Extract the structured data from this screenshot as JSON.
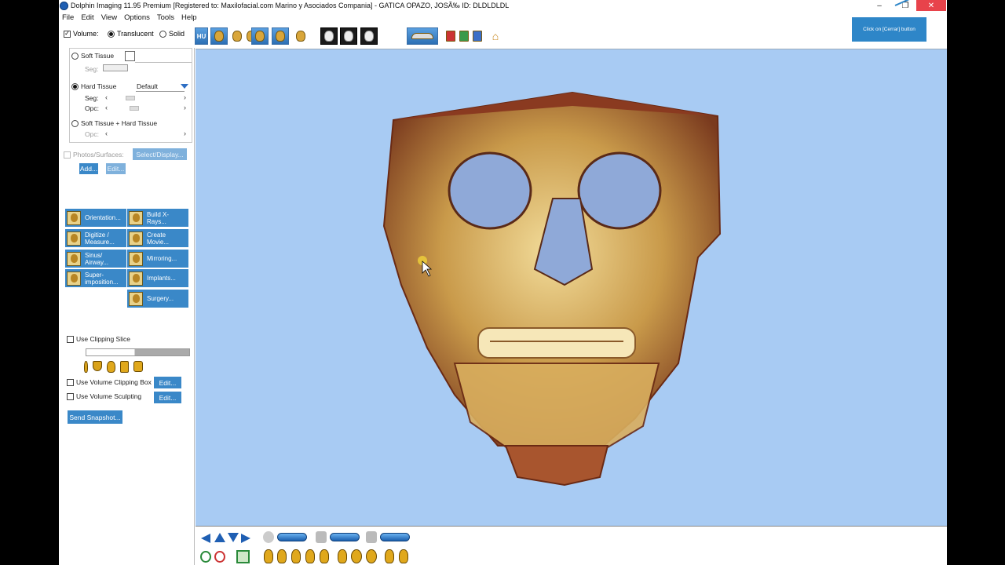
{
  "window": {
    "title": "Dolphin Imaging 11.95 Premium [Registered to: Maxilofacial.com Marino y Asociados Compania] - GATICA OPAZO, JOSÃ‰  ID: DLDLDLDL",
    "minimize": "–",
    "maximize": "❐",
    "close": "✕"
  },
  "menu": [
    "File",
    "Edit",
    "View",
    "Options",
    "Tools",
    "Help"
  ],
  "tooltip": "Click on [Cerrar] button",
  "toolbar": {
    "volume_label": "Volume:",
    "translucent_label": "Translucent",
    "solid_label": "Solid",
    "hu_label": "HU"
  },
  "tissue": {
    "soft_label": "Soft Tissue",
    "seg_label": "Seg:",
    "hard_label": "Hard Tissue",
    "preset_value": "Default",
    "opc_label": "Opc:",
    "soft_hard_label": "Soft Tissue + Hard Tissue",
    "selected": "Hard Tissue"
  },
  "photos": {
    "label": "Photos/Surfaces:",
    "select_display": "Select/Display...",
    "add": "Add...",
    "edit": "Edit..."
  },
  "tools": [
    {
      "label": "Orientation...",
      "icon": "orientation-icon"
    },
    {
      "label": "Build X-Rays...",
      "icon": "xray-icon"
    },
    {
      "label": "Digitize / Measure...",
      "icon": "digitize-icon"
    },
    {
      "label": "Create Movie...",
      "icon": "movie-icon"
    },
    {
      "label": "Sinus/ Airway...",
      "icon": "sinus-icon"
    },
    {
      "label": "Mirroring...",
      "icon": "mirroring-icon"
    },
    {
      "label": "Super- imposition...",
      "icon": "superimposition-icon"
    },
    {
      "label": "Implants...",
      "icon": "implant-icon"
    },
    {
      "label": "Surgery...",
      "icon": "surgery-icon"
    }
  ],
  "clipping": {
    "slice_label": "Use Clipping Slice",
    "box_label": "Use Volume Clipping Box",
    "sculpt_label": "Use Volume Sculpting",
    "edit": "Edit...",
    "snapshot": "Send Snapshot..."
  },
  "viewport": {
    "content": "3D CBCT skull volume rendering (frontal view)",
    "background": "#a8cbf3"
  },
  "colors": {
    "accent": "#3a88c8",
    "close": "#e8434b",
    "viewport": "#a8cbf3"
  }
}
